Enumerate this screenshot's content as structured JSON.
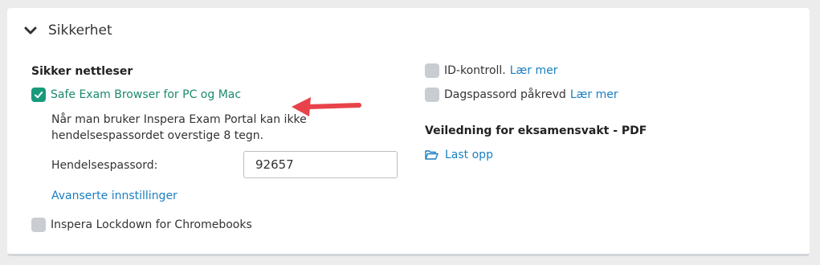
{
  "section": {
    "title": "Sikkerhet",
    "chevron_icon": "chevron-down-icon"
  },
  "secure_browser": {
    "heading": "Sikker nettleser",
    "seb": {
      "label": "Safe Exam Browser for PC og Mac",
      "checked": true
    },
    "note": "Når man bruker Inspera Exam Portal kan ikke hendelsespassordet overstige 8 tegn.",
    "password_label": "Hendelsespassord:",
    "password_value": "92657",
    "advanced_link": "Avanserte innstillinger",
    "chromebook": {
      "label": "Inspera Lockdown for Chromebooks",
      "checked": false
    }
  },
  "right": {
    "id_check": {
      "label": "ID-kontroll.",
      "link": "Lær mer",
      "checked": false
    },
    "day_password": {
      "label": "Dagspassord påkrevd",
      "link": "Lær mer",
      "checked": false
    },
    "guide_heading": "Veiledning for eksamensvakt - PDF",
    "upload": {
      "icon": "folder-open-icon",
      "label": "Last opp"
    }
  },
  "colors": {
    "accent_green": "#1a9a7c",
    "link_blue": "#1a7fc1",
    "annotation_arrow": "#e8424a"
  }
}
